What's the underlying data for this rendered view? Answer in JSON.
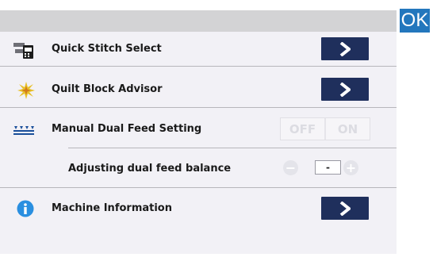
{
  "ok_button": {
    "label": "OK"
  },
  "menu": {
    "quick_stitch_select": {
      "label": "Quick Stitch Select",
      "icon": "stitch-selector-icon"
    },
    "quilt_block_advisor": {
      "label": "Quilt Block Advisor",
      "icon": "quilt-block-icon"
    },
    "manual_dual_feed": {
      "label": "Manual Dual Feed Setting",
      "icon": "dual-feed-icon",
      "toggle": {
        "off_label": "OFF",
        "on_label": "ON"
      }
    },
    "dual_feed_balance": {
      "label": "Adjusting dual feed balance",
      "value": "-",
      "minus": "−",
      "plus": "+"
    },
    "machine_information": {
      "label": "Machine Information",
      "icon": "info-icon"
    }
  },
  "colors": {
    "ok_blue": "#2377bd",
    "arrow_button_navy": "#1f2f5c",
    "panel_bg": "#f2f1f6",
    "top_bar": "#d3d3d5"
  }
}
